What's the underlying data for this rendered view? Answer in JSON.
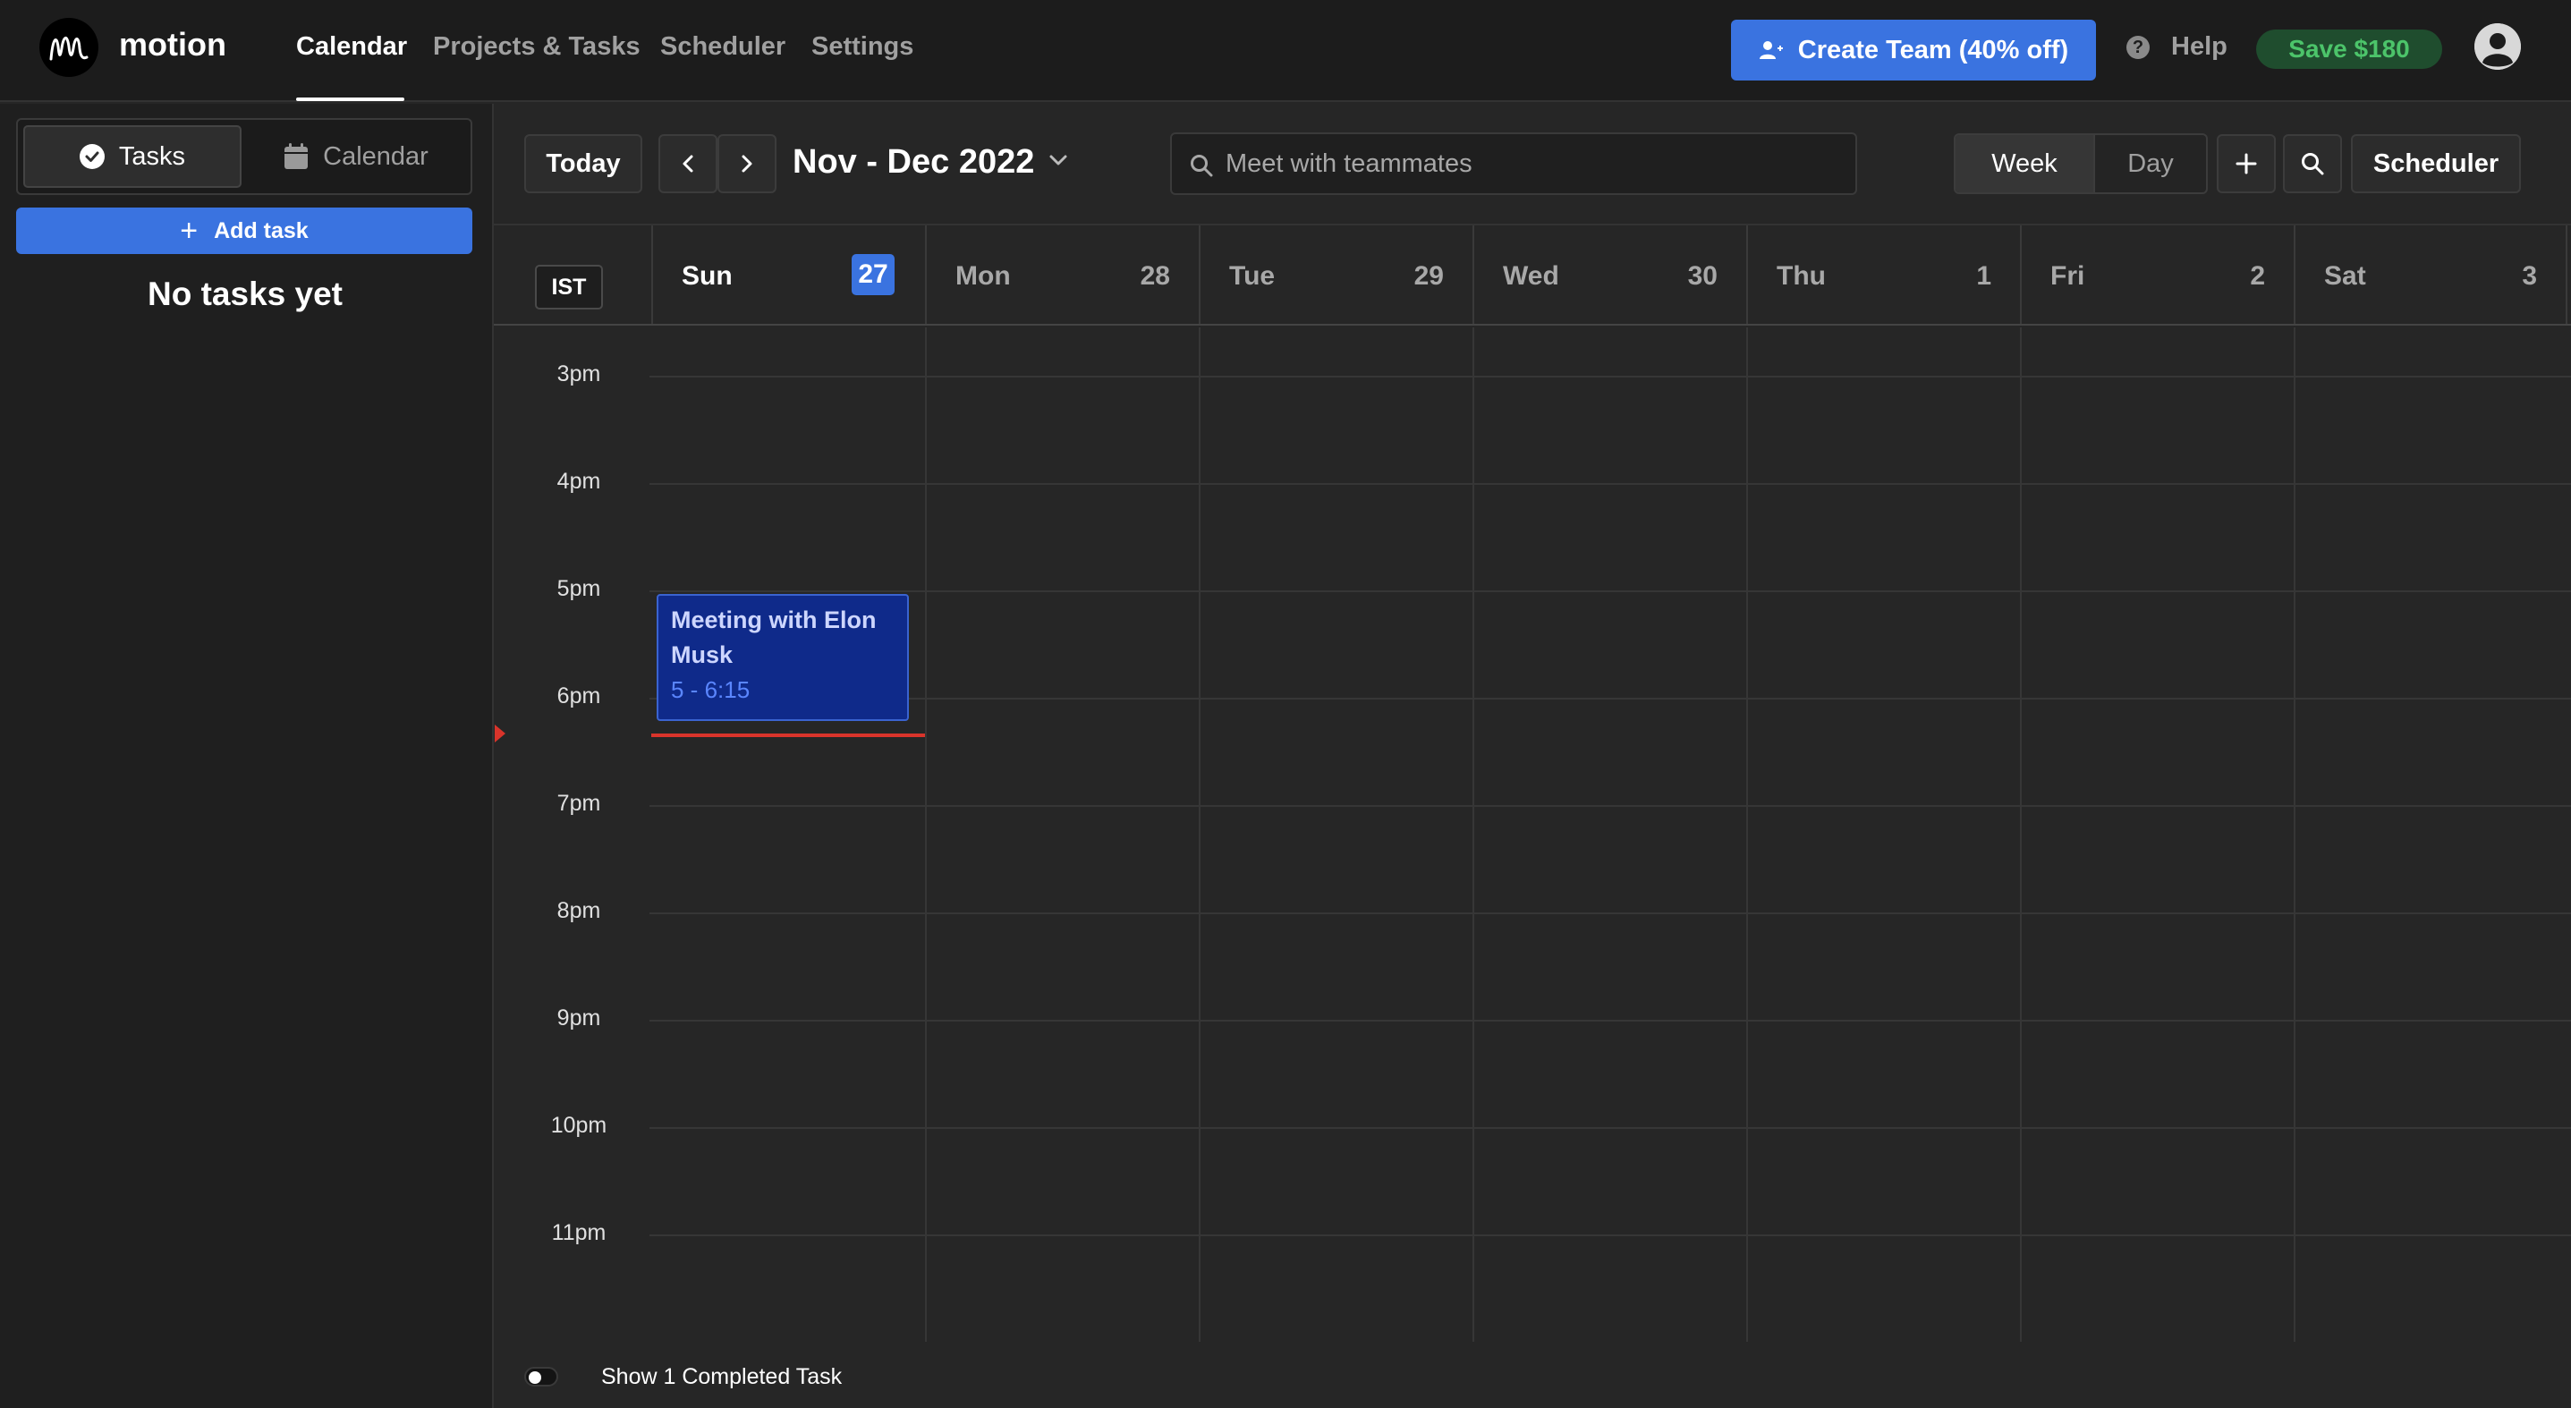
{
  "app": {
    "name": "motion"
  },
  "nav": {
    "items": [
      {
        "label": "Calendar",
        "active": true
      },
      {
        "label": "Projects & Tasks",
        "active": false
      },
      {
        "label": "Scheduler",
        "active": false
      },
      {
        "label": "Settings",
        "active": false
      }
    ],
    "create_team_label": "Create Team (40% off)",
    "help_label": "Help",
    "save_label": "Save $180"
  },
  "sidebar": {
    "tabs": [
      {
        "label": "Tasks",
        "icon": "check-circle-icon",
        "active": true
      },
      {
        "label": "Calendar",
        "icon": "calendar-icon",
        "active": false
      }
    ],
    "add_task_label": "Add task",
    "empty_message": "No tasks yet"
  },
  "toolbar": {
    "today_label": "Today",
    "date_range": "Nov - Dec 2022",
    "search_placeholder": "Meet with teammates",
    "view_week": "Week",
    "view_day": "Day",
    "active_view": "Week",
    "scheduler_label": "Scheduler"
  },
  "calendar": {
    "timezone": "IST",
    "days": [
      {
        "name": "Sun",
        "num": "27",
        "today": true
      },
      {
        "name": "Mon",
        "num": "28",
        "today": false
      },
      {
        "name": "Tue",
        "num": "29",
        "today": false
      },
      {
        "name": "Wed",
        "num": "30",
        "today": false
      },
      {
        "name": "Thu",
        "num": "1",
        "today": false
      },
      {
        "name": "Fri",
        "num": "2",
        "today": false
      },
      {
        "name": "Sat",
        "num": "3",
        "today": false
      }
    ],
    "hours": [
      "3pm",
      "4pm",
      "5pm",
      "6pm",
      "7pm",
      "8pm",
      "9pm",
      "10pm",
      "11pm"
    ],
    "events": [
      {
        "title": "Meeting with Elon Musk",
        "time": "5 - 6:15",
        "day": "Sun"
      }
    ]
  },
  "footer": {
    "toggle_label": "Show 1 Completed Task",
    "toggle_on": false
  },
  "colors": {
    "accent": "#3a73e0",
    "save_green": "#4cc46a",
    "now_line": "#d9342b",
    "event_bg": "#0f2a8a"
  }
}
